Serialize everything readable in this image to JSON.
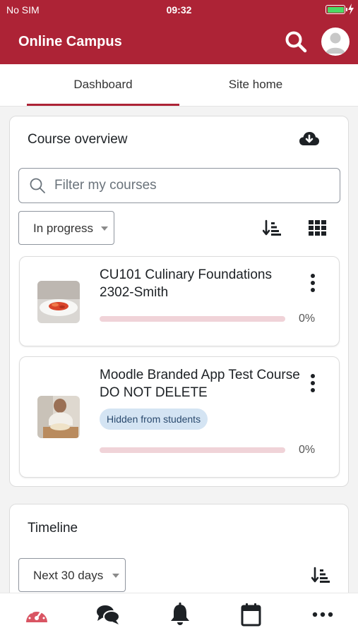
{
  "status_bar": {
    "carrier": "No SIM",
    "time": "09:32"
  },
  "app_bar": {
    "title": "Online Campus",
    "search_icon": "search-icon",
    "avatar_icon": "user-avatar-icon"
  },
  "tabs": [
    {
      "label": "Dashboard",
      "active": true
    },
    {
      "label": "Site home",
      "active": false
    }
  ],
  "course_overview": {
    "title": "Course overview",
    "download_icon": "cloud-download-icon",
    "filter_placeholder": "Filter my courses",
    "filter_value": "",
    "status_select": "In progress",
    "sort_icon": "sort-icon",
    "view_icon": "grid-view-icon",
    "courses": [
      {
        "name": "CU101 Culinary Foundations 2302-Smith",
        "progress_percent": 0,
        "progress_label": "0%",
        "hidden_badge": ""
      },
      {
        "name": "Moodle Branded App Test Course DO NOT DELETE",
        "progress_percent": 0,
        "progress_label": "0%",
        "hidden_badge": "Hidden from students"
      }
    ]
  },
  "timeline": {
    "title": "Timeline",
    "range_select": "Next 30 days",
    "sort_icon": "sort-icon"
  },
  "bottom_nav": [
    {
      "icon": "dashboard-gauge-icon",
      "active": true
    },
    {
      "icon": "messages-icon",
      "active": false
    },
    {
      "icon": "notifications-bell-icon",
      "active": false
    },
    {
      "icon": "calendar-icon",
      "active": false
    },
    {
      "icon": "more-icon",
      "active": false
    }
  ],
  "colors": {
    "brand": "#ad2336",
    "progress_track": "#f0d3d8",
    "badge_bg": "#d4e4f3"
  }
}
